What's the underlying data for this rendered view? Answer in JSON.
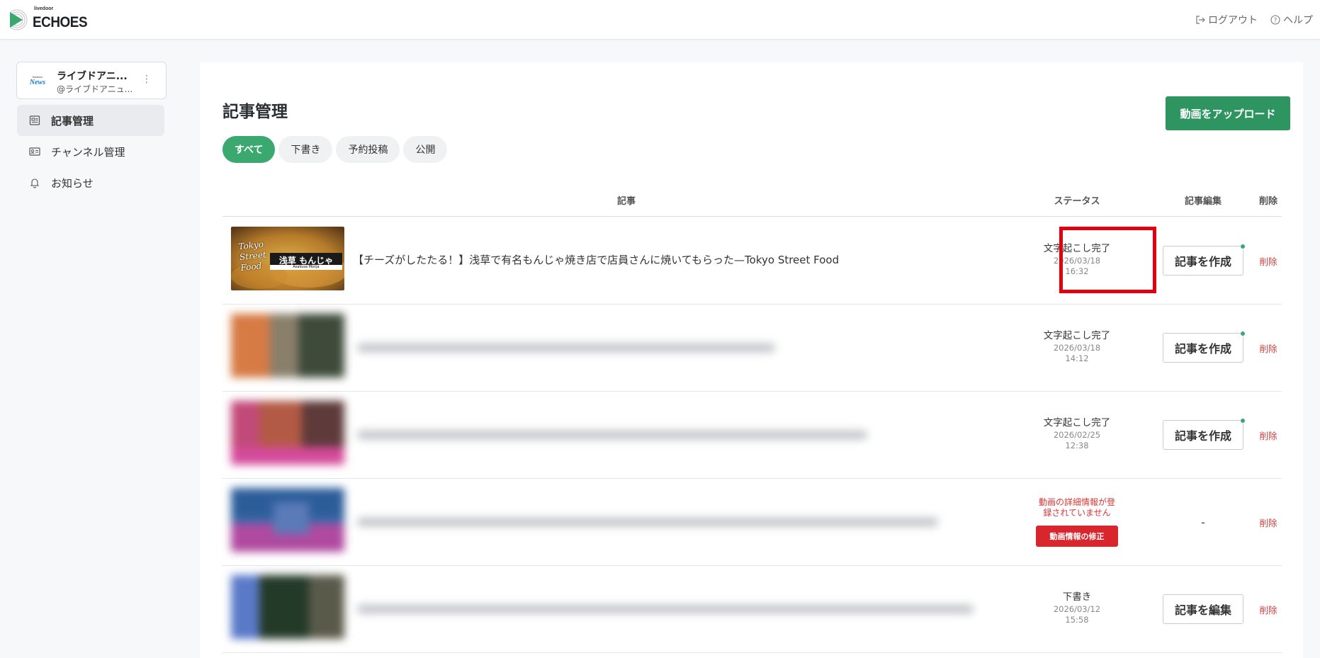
{
  "app": {
    "logo_small": "livedoor",
    "logo_main": "ECHOES",
    "logout": "ログアウト",
    "help": "ヘルプ"
  },
  "channel": {
    "logo_small": "livedoor",
    "logo_news": "News",
    "name": "ライブドアニ...",
    "handle": "@ライブドアニュ..."
  },
  "nav": [
    {
      "label": "記事管理",
      "icon": "article-icon",
      "active": true
    },
    {
      "label": "チャンネル管理",
      "icon": "id-card-icon",
      "active": false
    },
    {
      "label": "お知らせ",
      "icon": "bell-icon",
      "active": false
    }
  ],
  "main": {
    "title": "記事管理",
    "upload_label": "動画をアップロード",
    "tabs": [
      "すべて",
      "下書き",
      "予約投稿",
      "公開"
    ],
    "columns": {
      "article": "記事",
      "status": "ステータス",
      "edit": "記事編集",
      "delete": "削除"
    }
  },
  "rows": [
    {
      "title": "【チーズがしたたる！】浅草で有名もんじゃ焼き店で店員さんに焼いてもらった—Tokyo Street Food",
      "thumb_text": {
        "left": "Tokyo Street Food",
        "sign": "浅草 もんじゃ",
        "sign_sub": "Asakusa Monja"
      },
      "status": "文字起こし完了",
      "date": "2026/03/18",
      "time": "16:32",
      "edit_label": "記事を作成",
      "delete_label": "削除"
    },
    {
      "status": "文字起こし完了",
      "date": "2026/03/18",
      "time": "14:12",
      "edit_label": "記事を作成",
      "delete_label": "削除"
    },
    {
      "status": "文字起こし完了",
      "date": "2026/02/25",
      "time": "12:38",
      "edit_label": "記事を作成",
      "delete_label": "削除"
    },
    {
      "status_error": "動画の詳細情報が登録されていません",
      "fix_label": "動画情報の修正",
      "edit_label": "-",
      "delete_label": "削除"
    },
    {
      "status": "下書き",
      "date": "2026/03/12",
      "time": "15:58",
      "edit_label": "記事を編集",
      "delete_label": "削除"
    }
  ],
  "colors": {
    "accent_green": "#2e9460",
    "tab_active": "#3aa86f",
    "danger": "#d8262e",
    "highlight_box": "#e0000e"
  }
}
